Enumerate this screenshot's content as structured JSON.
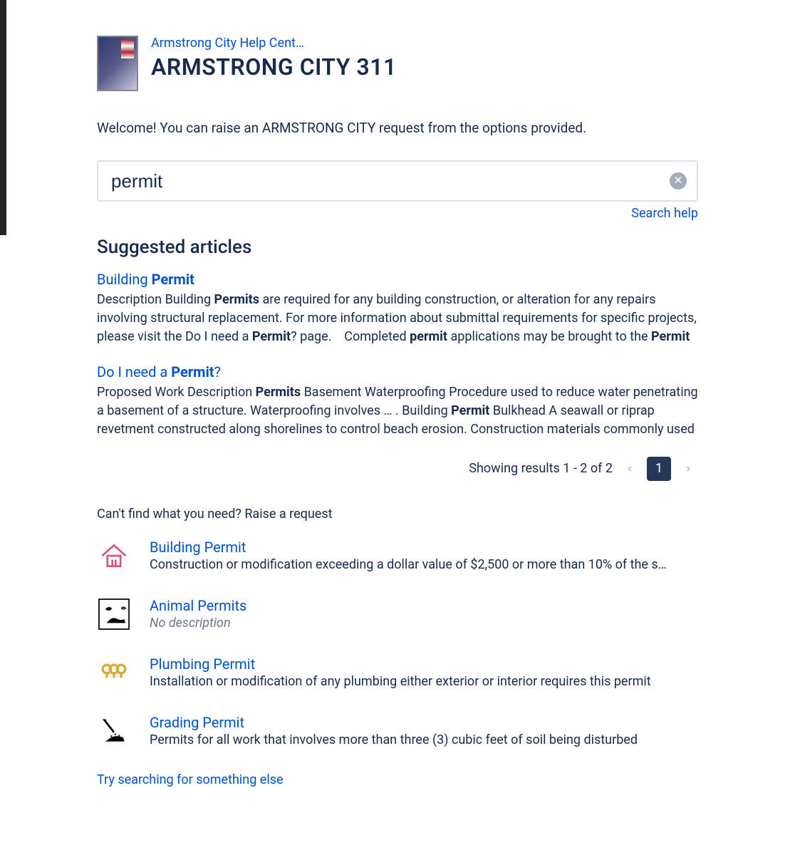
{
  "header": {
    "breadcrumb": "Armstrong City Help Cent…",
    "title": "ARMSTRONG CITY 311"
  },
  "welcome": "Welcome! You can raise an ARMSTRONG CITY request from the options provided.",
  "search": {
    "value": "permit",
    "help_label": "Search help"
  },
  "suggested_heading": "Suggested articles",
  "articles": [
    {
      "title_html": "Building <b>Permit</b>",
      "snippet_html": "Description Building <b>Permits</b> are required for any building construction, or alteration for any repairs involving structural replacement.  For more information about submittal requirements for specific projects, please visit the Do I need a <b>Permit</b>? page. &nbsp;&nbsp;&nbsp;Completed <b>permit</b> applications may be brought to the <b>Permit</b>"
    },
    {
      "title_html": "Do I need a <b>Permit</b>?",
      "snippet_html": "Proposed Work Description <b>Permits</b> Basement Waterproofing Procedure used to reduce water penetrating a basement of a structure. Waterproofing involves … . Building <b>Permit</b> Bulkhead A seawall or riprap revetment constructed along shorelines to control beach erosion. Construction materials commonly used"
    }
  ],
  "pagination": {
    "text": "Showing results 1 - 2 of 2",
    "current": "1"
  },
  "raise_heading": "Can't find what you need? Raise a request",
  "requests": [
    {
      "title": "Building Permit",
      "desc": "Construction or modification exceeding a dollar value of $2,500 or more than 10% of the s…",
      "italic": false
    },
    {
      "title": "Animal Permits",
      "desc": "No description",
      "italic": true
    },
    {
      "title": "Plumbing Permit",
      "desc": "Installation or modification of any plumbing either exterior or interior requires this permit",
      "italic": false
    },
    {
      "title": "Grading Permit",
      "desc": "Permits for all work that involves more than three (3) cubic feet of soil being disturbed",
      "italic": false
    }
  ],
  "other_link": "Try searching for something else"
}
